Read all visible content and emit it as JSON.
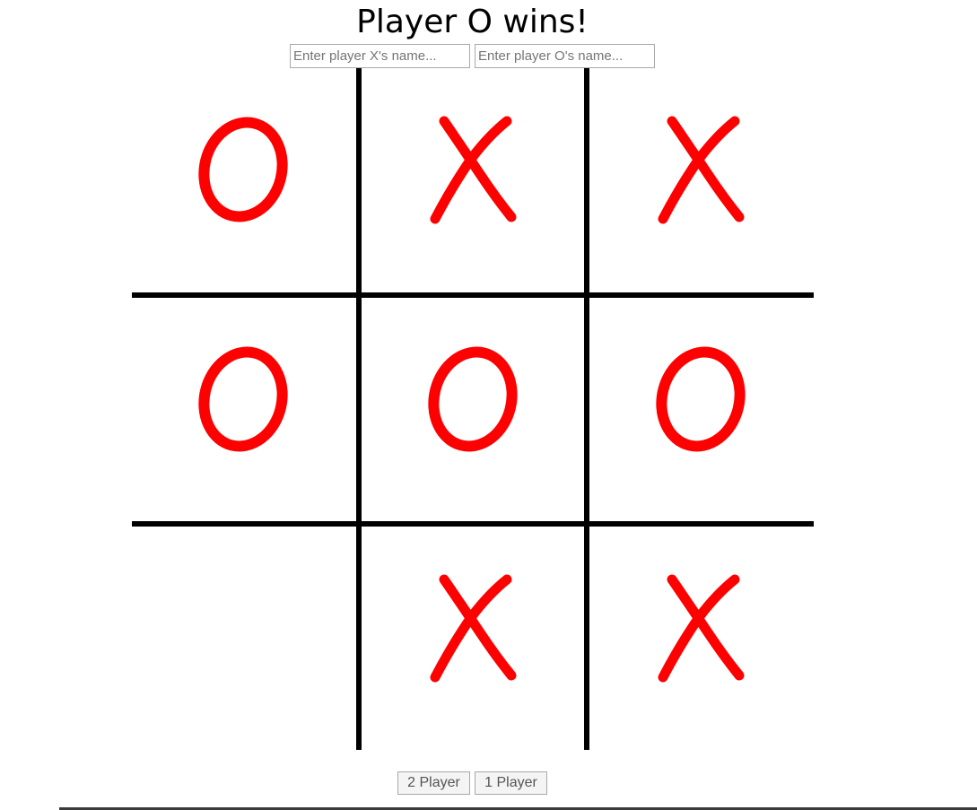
{
  "status": {
    "text": "Player O wins!"
  },
  "players": {
    "x_placeholder": "Enter player X's name...",
    "o_placeholder": "Enter player O's name..."
  },
  "board": {
    "mark_color": "#ff0000",
    "line_color": "#000000",
    "cells": [
      "O",
      "X",
      "X",
      "O",
      "O",
      "O",
      "",
      "X",
      "X"
    ]
  },
  "buttons": {
    "two_player": "2 Player",
    "one_player": "1 Player"
  }
}
